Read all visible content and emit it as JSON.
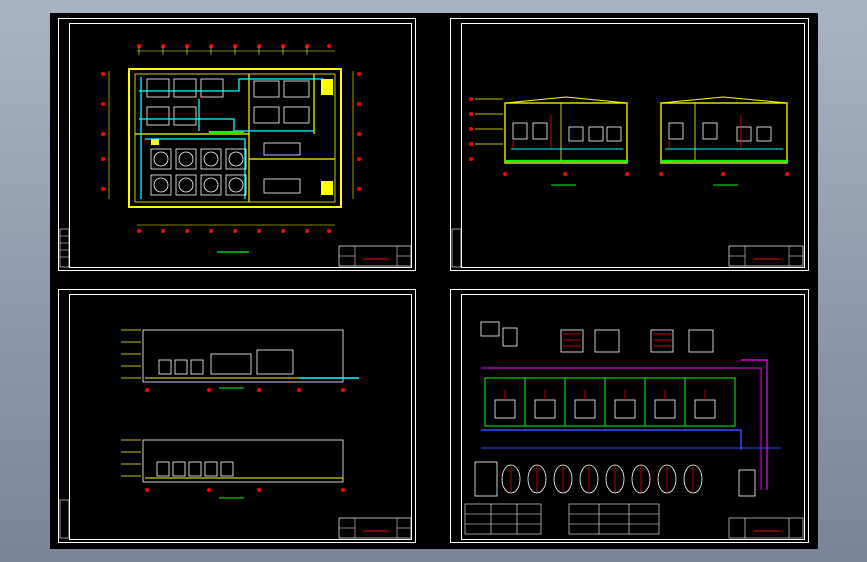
{
  "colors": {
    "background": "#000000",
    "frame": "#ffffff",
    "wall": "#ffff00",
    "pipe": "#00ffff",
    "axis_marker": "#ff0000",
    "equipment": "#ffffff",
    "line_green": "#00ff00",
    "line_magenta": "#ff00ff",
    "line_blue": "#3050ff",
    "desktop": "#98a4b4"
  },
  "sheets": [
    {
      "id": "plan",
      "view": "floor-plan"
    },
    {
      "id": "sections",
      "view": "sections"
    },
    {
      "id": "elevations",
      "view": "elevations"
    },
    {
      "id": "schematic",
      "view": "process-schematic"
    }
  ]
}
